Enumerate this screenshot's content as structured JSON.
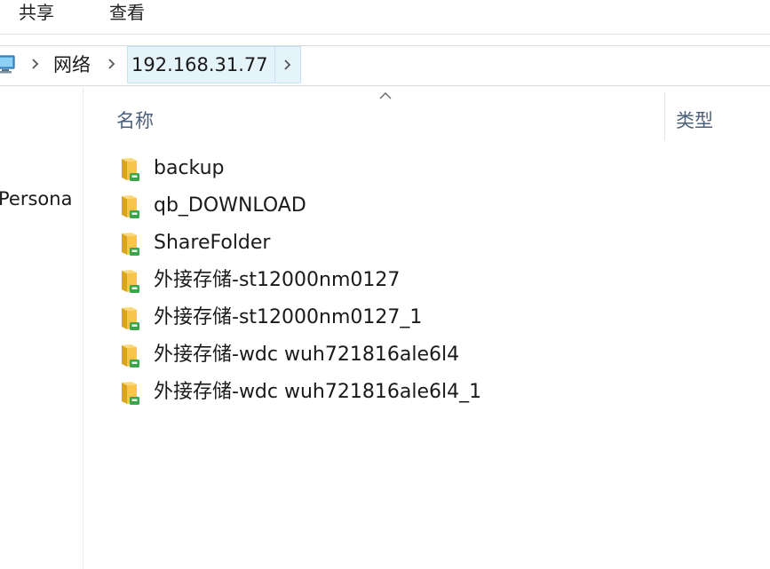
{
  "ribbon": {
    "tabs": [
      {
        "label": "共享"
      },
      {
        "label": "查看"
      }
    ]
  },
  "address": {
    "crumbs": [
      {
        "label": "网络"
      },
      {
        "label": "192.168.31.77"
      }
    ]
  },
  "nav_pane": {
    "items": [
      {
        "label": "Persona"
      }
    ]
  },
  "columns": [
    {
      "label": "名称"
    },
    {
      "label": "类型"
    }
  ],
  "files": [
    {
      "name": "backup",
      "icon": "shared-folder-icon"
    },
    {
      "name": "qb_DOWNLOAD",
      "icon": "shared-folder-icon"
    },
    {
      "name": "ShareFolder",
      "icon": "shared-folder-icon"
    },
    {
      "name": "外接存储-st12000nm0127",
      "icon": "shared-folder-icon"
    },
    {
      "name": "外接存储-st12000nm0127_1",
      "icon": "shared-folder-icon"
    },
    {
      "name": "外接存储-wdc wuh721816ale6l4",
      "icon": "shared-folder-icon"
    },
    {
      "name": "外接存储-wdc wuh721816ale6l4_1",
      "icon": "shared-folder-icon"
    }
  ],
  "colors": {
    "folder": "#f6c54a",
    "folder_dark": "#d9a520",
    "share_badge": "#3aa64b",
    "header_text": "#4c607a",
    "selected_crumb_bg": "#e5f3fb"
  }
}
